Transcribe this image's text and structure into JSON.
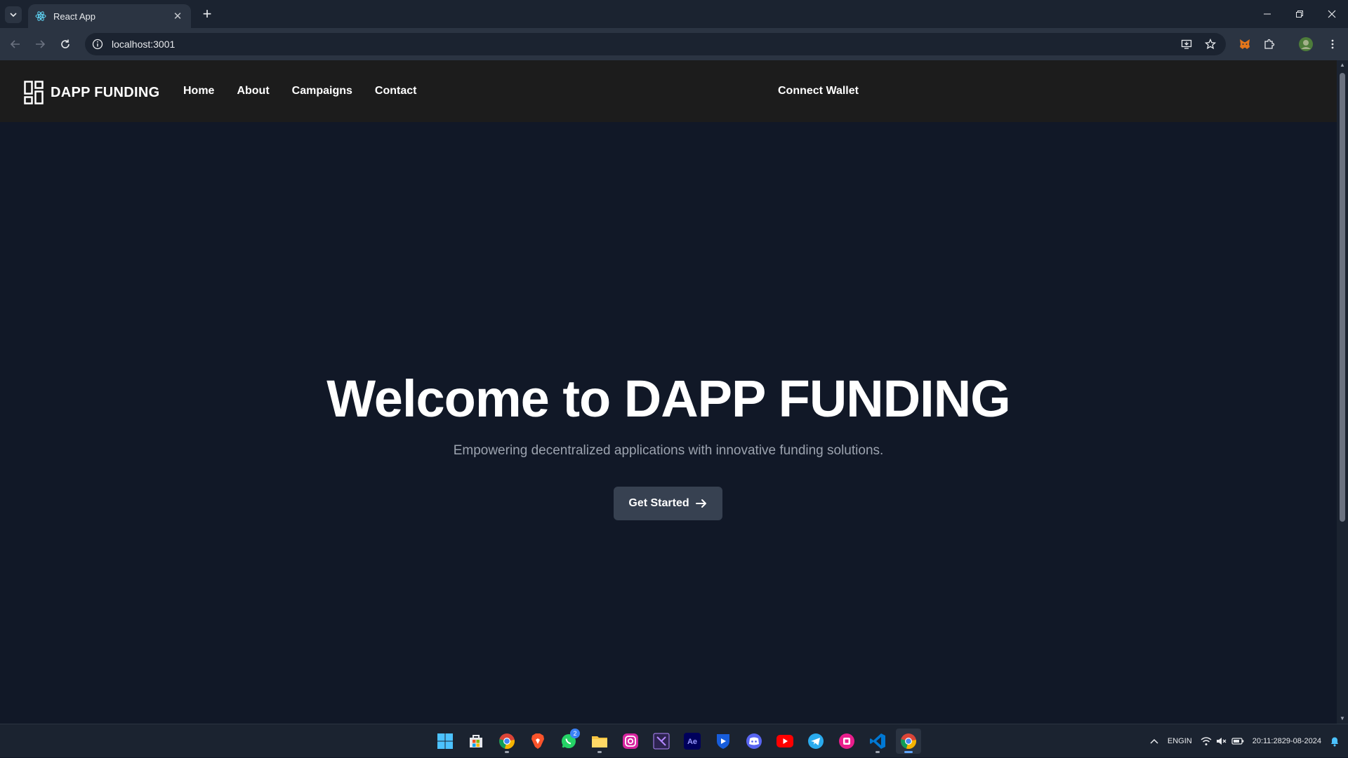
{
  "browser": {
    "tab_title": "React App",
    "url": "localhost:3001",
    "new_tab_label": "+",
    "tab_close": "✕"
  },
  "navbar": {
    "brand": "DAPP FUNDING",
    "links": [
      "Home",
      "About",
      "Campaigns",
      "Contact"
    ],
    "connect_wallet": "Connect Wallet"
  },
  "hero": {
    "title": "Welcome to DAPP FUNDING",
    "subtitle": "Empowering decentralized applications with innovative funding solutions.",
    "cta": "Get Started"
  },
  "taskbar": {
    "apps": [
      "start-icon",
      "store-icon",
      "chrome-icon",
      "brave-icon",
      "whatsapp-icon",
      "file-explorer-icon",
      "instagram-icon",
      "visual-studio-icon",
      "after-effects-icon",
      "bitwarden-icon",
      "discord-icon",
      "youtube-icon",
      "telegram-icon",
      "app-icon",
      "vscode-icon",
      "chrome-active-icon"
    ],
    "whatsapp_badge": "2",
    "after_effects_label": "Ae",
    "language": "ENG",
    "region": "IN",
    "time": "20:11:28",
    "date": "29-08-2024"
  },
  "colors": {
    "page_bg": "#111827",
    "navbar_bg": "#1c1c1c",
    "button_bg": "#374151",
    "subtitle": "#9ca3af"
  }
}
